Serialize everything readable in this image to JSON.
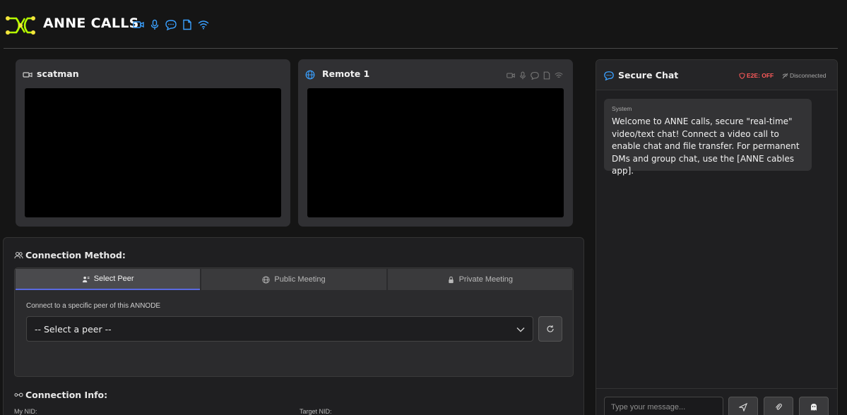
{
  "app": {
    "title": "ANNE CALLS",
    "brand_color": "#b6ff00",
    "header_icons": [
      "video-icon",
      "microphone-icon",
      "chat-bubble-icon",
      "file-icon",
      "wifi-icon"
    ]
  },
  "videos": {
    "local": {
      "name": "scatman",
      "icon": "user-camera-icon"
    },
    "remote": {
      "name": "Remote 1",
      "icon": "globe-icon",
      "status_icons": [
        "video-icon",
        "microphone-icon",
        "chat-bubble-icon",
        "file-icon",
        "wifi-icon"
      ]
    }
  },
  "connection": {
    "method_label": "Connection Method:",
    "tabs": [
      {
        "label": "Select Peer",
        "icon": "users-icon",
        "active": true
      },
      {
        "label": "Public Meeting",
        "icon": "globe-icon",
        "active": false
      },
      {
        "label": "Private Meeting",
        "icon": "lock-icon",
        "active": false
      }
    ],
    "hint": "Connect to a specific peer of this ANNODE",
    "select_value": "-- Select a peer --",
    "info_label": "Connection Info:",
    "my_nid_label": "My NID:",
    "target_nid_label": "Target NID:"
  },
  "chat": {
    "title": "Secure Chat",
    "e2e": "E2E: OFF",
    "status": "Disconnected",
    "status_color": "#ff5a5a",
    "messages": [
      {
        "sender": "System",
        "text": "Welcome to ANNE calls, secure \"real-time\" video/text chat! Connect a video call to enable chat and file transfer. For permanent DMs and group chat, use the [ANNE cables app]."
      }
    ],
    "input_placeholder": "Type your message..."
  }
}
